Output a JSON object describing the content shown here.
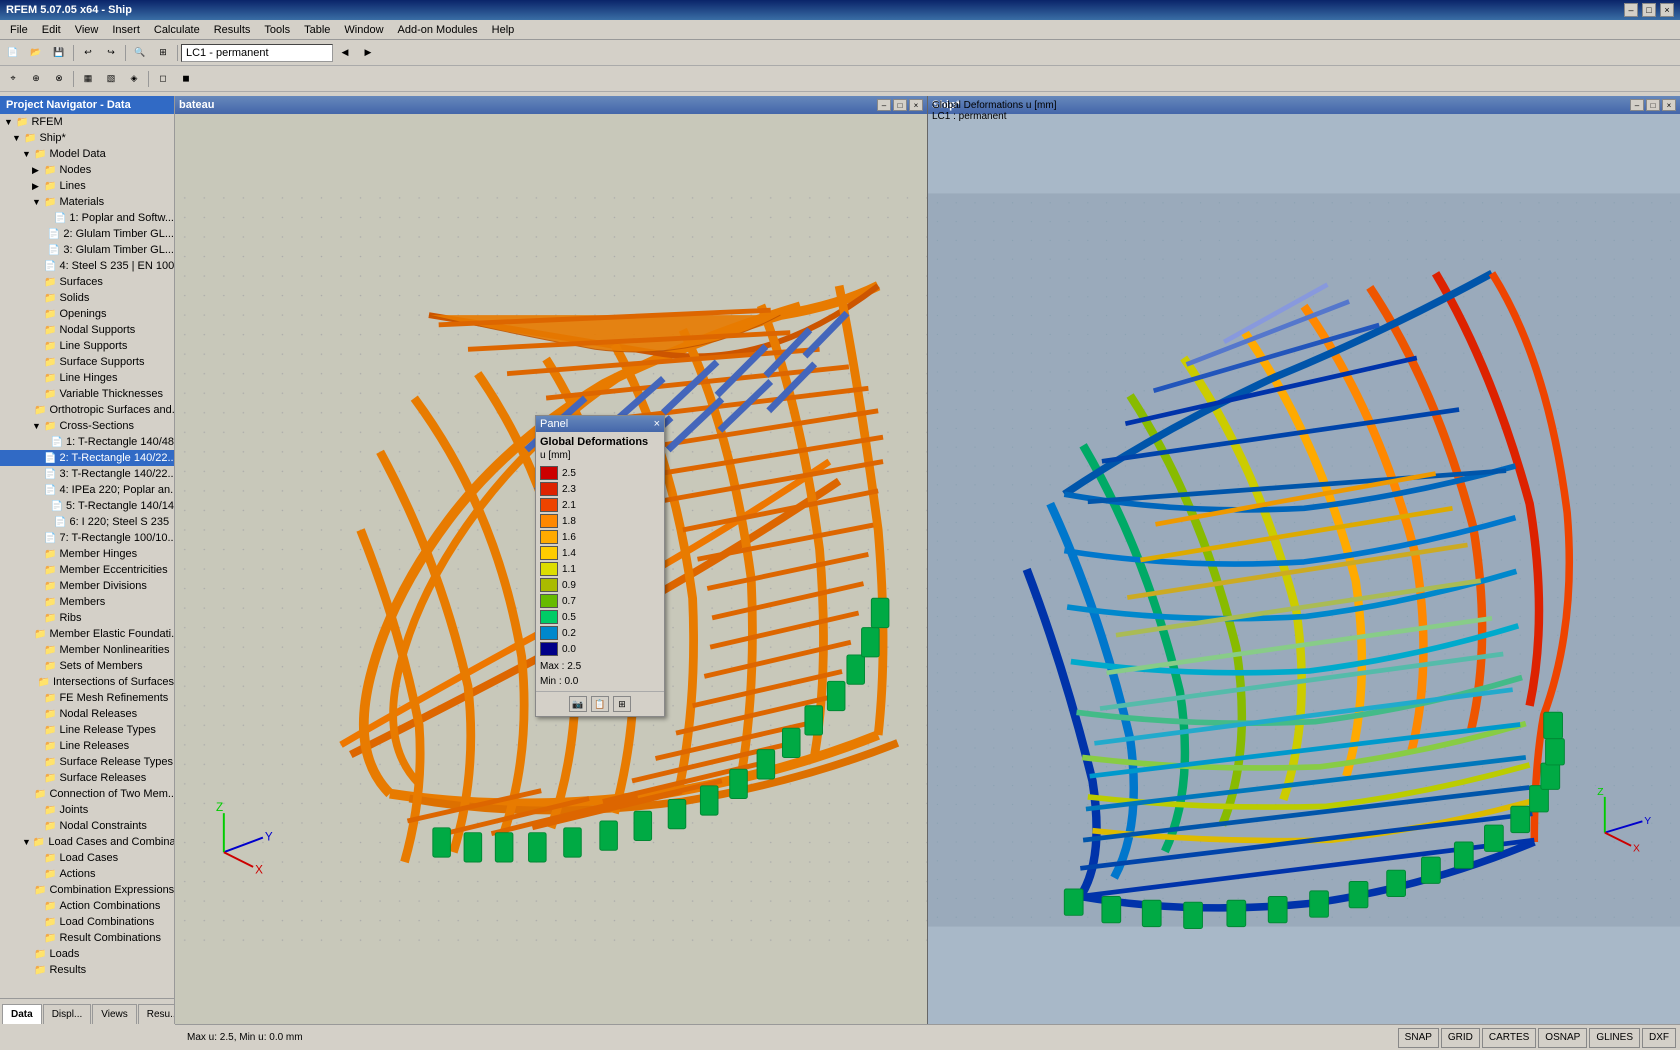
{
  "app": {
    "title": "RFEM 5.07.05 x64 - Ship",
    "window_controls": [
      "–",
      "□",
      "×"
    ]
  },
  "menu": {
    "items": [
      "File",
      "Edit",
      "View",
      "Insert",
      "Calculate",
      "Results",
      "Tools",
      "Table",
      "Window",
      "Add-on Modules",
      "Help"
    ]
  },
  "toolbar": {
    "lc_dropdown": "LC1 - permanent"
  },
  "navigator": {
    "title": "Project Navigator - Data",
    "tree": [
      {
        "id": "rfem",
        "label": "RFEM",
        "indent": 0,
        "expanded": true,
        "type": "root"
      },
      {
        "id": "ship",
        "label": "Ship*",
        "indent": 1,
        "expanded": true,
        "type": "project"
      },
      {
        "id": "model-data",
        "label": "Model Data",
        "indent": 2,
        "expanded": true,
        "type": "folder"
      },
      {
        "id": "nodes",
        "label": "Nodes",
        "indent": 3,
        "expanded": false,
        "type": "folder"
      },
      {
        "id": "lines",
        "label": "Lines",
        "indent": 3,
        "expanded": false,
        "type": "folder"
      },
      {
        "id": "materials",
        "label": "Materials",
        "indent": 3,
        "expanded": true,
        "type": "folder"
      },
      {
        "id": "mat1",
        "label": "1: Poplar and Softw...",
        "indent": 4,
        "type": "item"
      },
      {
        "id": "mat2",
        "label": "2: Glulam Timber GL...",
        "indent": 4,
        "type": "item"
      },
      {
        "id": "mat3",
        "label": "3: Glulam Timber GL...",
        "indent": 4,
        "type": "item"
      },
      {
        "id": "mat4",
        "label": "4: Steel S 235 | EN 100",
        "indent": 4,
        "type": "item"
      },
      {
        "id": "surfaces",
        "label": "Surfaces",
        "indent": 3,
        "type": "folder"
      },
      {
        "id": "solids",
        "label": "Solids",
        "indent": 3,
        "type": "folder"
      },
      {
        "id": "openings",
        "label": "Openings",
        "indent": 3,
        "type": "folder"
      },
      {
        "id": "nodal-supports",
        "label": "Nodal Supports",
        "indent": 3,
        "type": "folder"
      },
      {
        "id": "line-supports",
        "label": "Line Supports",
        "indent": 3,
        "type": "folder"
      },
      {
        "id": "surface-supports",
        "label": "Surface Supports",
        "indent": 3,
        "type": "folder"
      },
      {
        "id": "line-hinges",
        "label": "Line Hinges",
        "indent": 3,
        "type": "folder"
      },
      {
        "id": "variable-thicknesses",
        "label": "Variable Thicknesses",
        "indent": 3,
        "type": "folder"
      },
      {
        "id": "orthotropic",
        "label": "Orthotropic Surfaces and...",
        "indent": 3,
        "type": "folder"
      },
      {
        "id": "cross-sections",
        "label": "Cross-Sections",
        "indent": 3,
        "expanded": true,
        "type": "folder"
      },
      {
        "id": "cs1",
        "label": "1: T-Rectangle 140/48",
        "indent": 4,
        "type": "item"
      },
      {
        "id": "cs2",
        "label": "2: T-Rectangle 140/22...",
        "indent": 4,
        "type": "item",
        "selected": true
      },
      {
        "id": "cs3",
        "label": "3: T-Rectangle 140/22...",
        "indent": 4,
        "type": "item"
      },
      {
        "id": "cs4",
        "label": "4: IPEa 220; Poplar an...",
        "indent": 4,
        "type": "item"
      },
      {
        "id": "cs5",
        "label": "5: T-Rectangle 140/14",
        "indent": 4,
        "type": "item"
      },
      {
        "id": "cs6",
        "label": "6: I 220; Steel S 235",
        "indent": 4,
        "type": "item"
      },
      {
        "id": "cs7",
        "label": "7: T-Rectangle 100/10...",
        "indent": 4,
        "type": "item"
      },
      {
        "id": "member-hinges",
        "label": "Member Hinges",
        "indent": 3,
        "type": "folder"
      },
      {
        "id": "member-eccentricities",
        "label": "Member Eccentricities",
        "indent": 3,
        "type": "folder"
      },
      {
        "id": "member-divisions",
        "label": "Member Divisions",
        "indent": 3,
        "type": "folder"
      },
      {
        "id": "members",
        "label": "Members",
        "indent": 3,
        "type": "folder"
      },
      {
        "id": "ribs",
        "label": "Ribs",
        "indent": 3,
        "type": "folder"
      },
      {
        "id": "member-elastic",
        "label": "Member Elastic Foundati...",
        "indent": 3,
        "type": "folder"
      },
      {
        "id": "member-nonlinearities",
        "label": "Member Nonlinearities",
        "indent": 3,
        "type": "folder"
      },
      {
        "id": "sets-of-members",
        "label": "Sets of Members",
        "indent": 3,
        "type": "folder"
      },
      {
        "id": "intersections",
        "label": "Intersections of Surfaces",
        "indent": 3,
        "type": "folder"
      },
      {
        "id": "fe-mesh",
        "label": "FE Mesh Refinements",
        "indent": 3,
        "type": "folder"
      },
      {
        "id": "nodal-releases",
        "label": "Nodal Releases",
        "indent": 3,
        "type": "folder"
      },
      {
        "id": "line-release-types",
        "label": "Line Release Types",
        "indent": 3,
        "type": "folder"
      },
      {
        "id": "line-releases",
        "label": "Line Releases",
        "indent": 3,
        "type": "folder"
      },
      {
        "id": "surface-release-types",
        "label": "Surface Release Types",
        "indent": 3,
        "type": "folder"
      },
      {
        "id": "surface-releases",
        "label": "Surface Releases",
        "indent": 3,
        "type": "folder"
      },
      {
        "id": "connection-two-members",
        "label": "Connection of Two Mem...",
        "indent": 3,
        "type": "folder"
      },
      {
        "id": "joints",
        "label": "Joints",
        "indent": 3,
        "type": "folder"
      },
      {
        "id": "nodal-constraints",
        "label": "Nodal Constraints",
        "indent": 3,
        "type": "folder"
      },
      {
        "id": "load-cases-combinations",
        "label": "Load Cases and Combinatio...",
        "indent": 2,
        "expanded": true,
        "type": "folder"
      },
      {
        "id": "load-cases",
        "label": "Load Cases",
        "indent": 3,
        "type": "folder"
      },
      {
        "id": "actions",
        "label": "Actions",
        "indent": 3,
        "type": "folder"
      },
      {
        "id": "combination-expressions",
        "label": "Combination Expressions",
        "indent": 3,
        "type": "folder"
      },
      {
        "id": "action-combinations",
        "label": "Action Combinations",
        "indent": 3,
        "type": "folder"
      },
      {
        "id": "load-combinations",
        "label": "Load Combinations",
        "indent": 3,
        "type": "folder"
      },
      {
        "id": "result-combinations",
        "label": "Result Combinations",
        "indent": 3,
        "type": "folder"
      },
      {
        "id": "loads",
        "label": "Loads",
        "indent": 2,
        "type": "folder"
      },
      {
        "id": "results",
        "label": "Results",
        "indent": 2,
        "type": "folder"
      }
    ],
    "bottom_tabs": [
      {
        "id": "data",
        "label": "Data",
        "active": true
      },
      {
        "id": "display",
        "label": "Displ...",
        "active": false
      },
      {
        "id": "views",
        "label": "Views",
        "active": false
      },
      {
        "id": "results",
        "label": "Resu...",
        "active": false
      }
    ]
  },
  "viewport_left": {
    "title": "bateau",
    "background": "#c8c8ba"
  },
  "viewport_right": {
    "title": "Ship*",
    "subtitle": "Global Deformations u [mm]",
    "lc": "LC1 : permanent",
    "background": "#a8b8c8"
  },
  "panel": {
    "title": "Panel",
    "close_btn": "×",
    "heading": "Global Deformations",
    "unit": "u [mm]",
    "legend": [
      {
        "value": "2.5",
        "color": "#cc0000"
      },
      {
        "value": "2.3",
        "color": "#dd2200"
      },
      {
        "value": "2.1",
        "color": "#ee4400"
      },
      {
        "value": "1.8",
        "color": "#ff8800"
      },
      {
        "value": "1.6",
        "color": "#ffaa00"
      },
      {
        "value": "1.4",
        "color": "#ffcc00"
      },
      {
        "value": "1.1",
        "color": "#dddd00"
      },
      {
        "value": "0.9",
        "color": "#aabb00"
      },
      {
        "value": "0.7",
        "color": "#66bb00"
      },
      {
        "value": "0.5",
        "color": "#00cc66"
      },
      {
        "value": "0.2",
        "color": "#0088cc"
      },
      {
        "value": "0.0",
        "color": "#000088"
      }
    ],
    "max_label": "Max :",
    "max_value": "2.5",
    "min_label": "Min :",
    "min_value": "0.0",
    "footer_buttons": [
      "📷",
      "📋",
      "🔲"
    ]
  },
  "status_bar": {
    "info": "Max u: 2.5, Min u: 0.0 mm",
    "buttons": [
      "SNAP",
      "GRID",
      "CARTES",
      "OSNAP",
      "GLINES",
      "DXF"
    ]
  }
}
